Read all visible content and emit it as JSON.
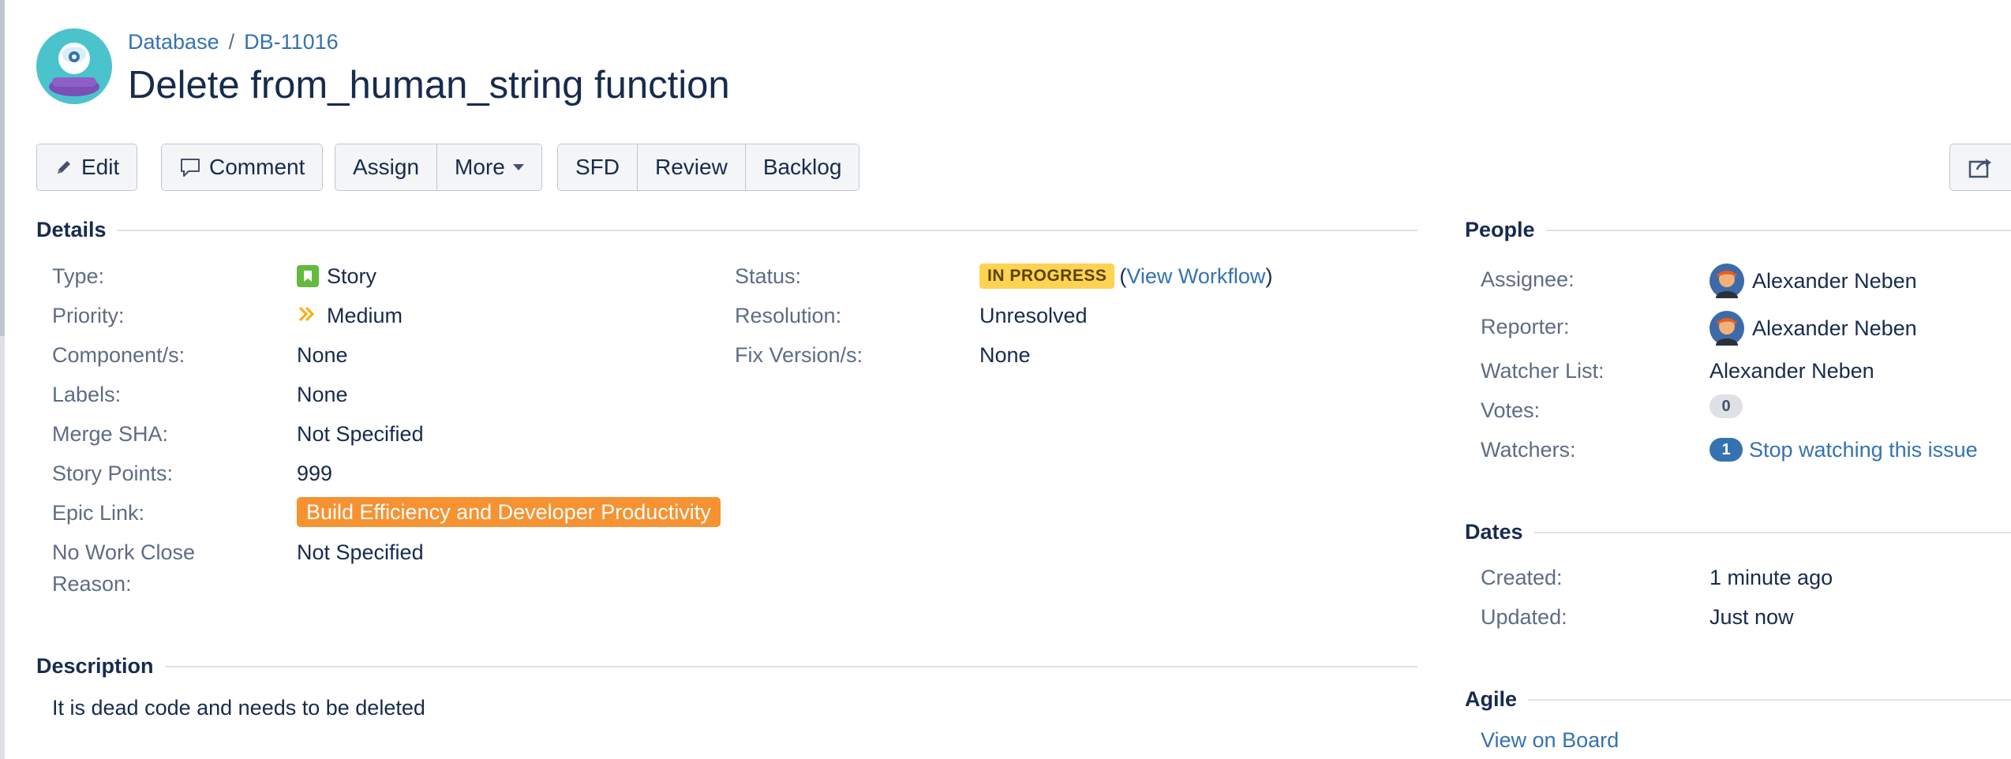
{
  "breadcrumb": {
    "project": "Database",
    "separator": "/",
    "issue_key": "DB-11016"
  },
  "issue": {
    "title": "Delete from_human_string function"
  },
  "toolbar": {
    "edit": "Edit",
    "comment": "Comment",
    "assign": "Assign",
    "more": "More",
    "sfd": "SFD",
    "review": "Review",
    "backlog": "Backlog"
  },
  "details": {
    "heading": "Details",
    "type_label": "Type:",
    "type_value": "Story",
    "priority_label": "Priority:",
    "priority_value": "Medium",
    "component_label": "Component/s:",
    "component_value": "None",
    "labels_label": "Labels:",
    "labels_value": "None",
    "merge_sha_label": "Merge SHA:",
    "merge_sha_value": "Not Specified",
    "story_points_label": "Story Points:",
    "story_points_value": "999",
    "epic_link_label": "Epic Link:",
    "epic_link_value": "Build Efficiency and Developer Productivity",
    "no_work_label_line1": "No Work Close",
    "no_work_label_line2": "Reason:",
    "no_work_value": "Not Specified",
    "status_label": "Status:",
    "status_value": "IN PROGRESS",
    "view_workflow_open": "(",
    "view_workflow": "View Workflow",
    "view_workflow_close": ")",
    "resolution_label": "Resolution:",
    "resolution_value": "Unresolved",
    "fix_version_label": "Fix Version/s:",
    "fix_version_value": "None"
  },
  "description": {
    "heading": "Description",
    "text": "It is dead code and needs to be deleted"
  },
  "people": {
    "heading": "People",
    "assignee_label": "Assignee:",
    "assignee_value": "Alexander Neben",
    "reporter_label": "Reporter:",
    "reporter_value": "Alexander Neben",
    "watcher_list_label": "Watcher List:",
    "watcher_list_value": "Alexander Neben",
    "votes_label": "Votes:",
    "votes_count": "0",
    "watchers_label": "Watchers:",
    "watchers_count": "1",
    "stop_watching": "Stop watching this issue"
  },
  "dates": {
    "heading": "Dates",
    "created_label": "Created:",
    "created_value": "1 minute ago",
    "updated_label": "Updated:",
    "updated_value": "Just now"
  },
  "agile": {
    "heading": "Agile",
    "view_on_board": "View on Board"
  },
  "colors": {
    "link": "#3572b0",
    "status_lozenge": "#ffd351",
    "epic_lozenge": "#f79232",
    "story_icon": "#63ba3c",
    "priority_icon": "#ffab00"
  },
  "icons": {
    "project": "project-avatar",
    "edit": "pencil-icon",
    "comment": "speech-bubble-icon",
    "more": "chevron-down-icon",
    "share": "share-icon",
    "type": "story-icon",
    "priority": "medium-priority-icon",
    "user": "user-avatar"
  }
}
